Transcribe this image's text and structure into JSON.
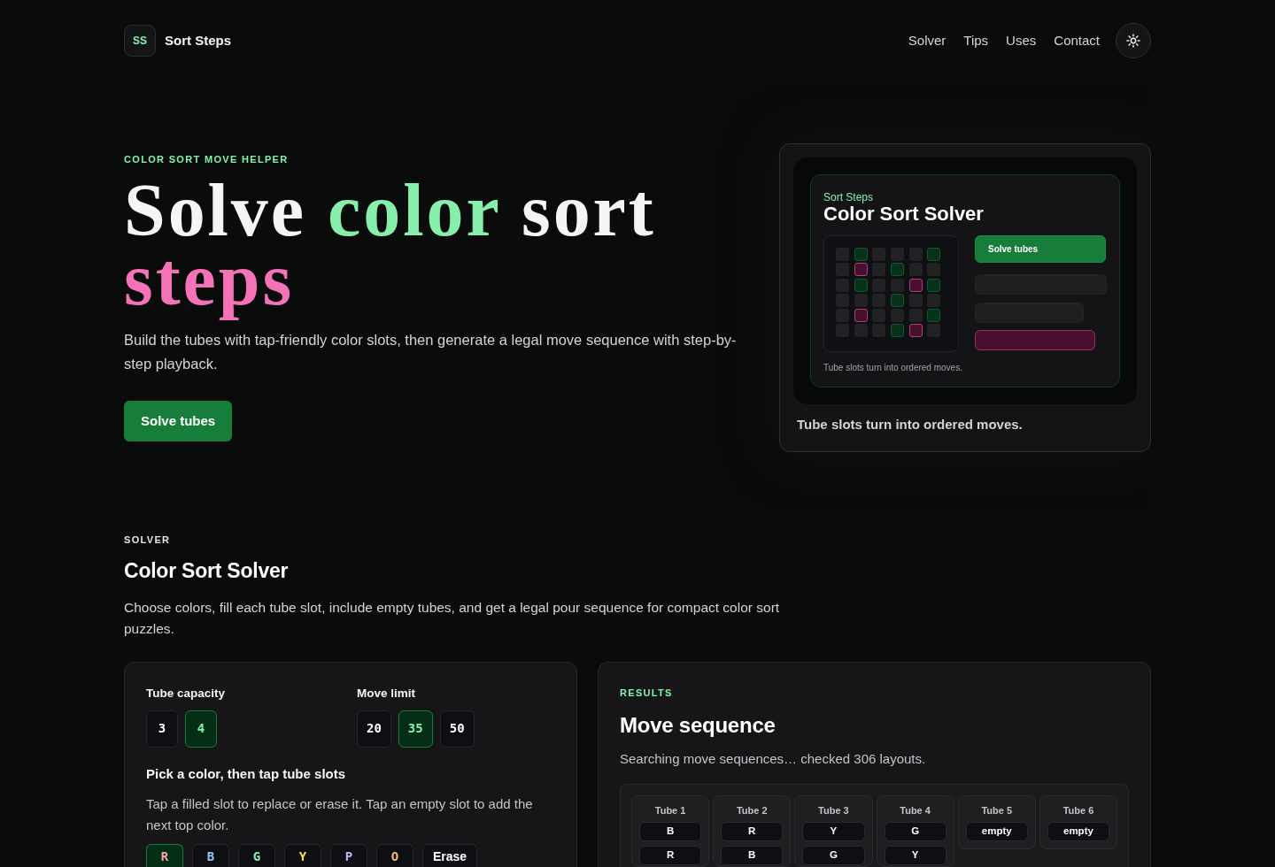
{
  "header": {
    "logo_mark": "SS",
    "brand": "Sort Steps",
    "nav": [
      {
        "label": "Solver"
      },
      {
        "label": "Tips"
      },
      {
        "label": "Uses"
      },
      {
        "label": "Contact"
      }
    ]
  },
  "hero": {
    "eyebrow": "COLOR SORT MOVE HELPER",
    "title_parts": [
      {
        "text": "Solve",
        "color": "#f5f5f5"
      },
      {
        "text": "color",
        "color": "#86efac"
      },
      {
        "text": "sort",
        "color": "#f5f5f5"
      },
      {
        "text": "steps",
        "color": "#f472b6"
      }
    ],
    "description": "Build the tubes with tap-friendly color slots, then generate a legal move sequence with step-by-step playback.",
    "cta": "Solve tubes"
  },
  "preview": {
    "brand": "Sort Steps",
    "title": "Color Sort Solver",
    "cells": [
      {
        "kind": "empty"
      },
      {
        "kind": "green"
      },
      {
        "kind": "empty"
      },
      {
        "kind": "empty"
      },
      {
        "kind": "empty"
      },
      {
        "kind": "green"
      },
      {
        "kind": "empty"
      },
      {
        "kind": "pink"
      },
      {
        "kind": "empty"
      },
      {
        "kind": "green"
      },
      {
        "kind": "empty"
      },
      {
        "kind": "empty"
      },
      {
        "kind": "empty"
      },
      {
        "kind": "green"
      },
      {
        "kind": "empty"
      },
      {
        "kind": "empty"
      },
      {
        "kind": "pink"
      },
      {
        "kind": "green"
      },
      {
        "kind": "empty"
      },
      {
        "kind": "empty"
      },
      {
        "kind": "empty"
      },
      {
        "kind": "green"
      },
      {
        "kind": "empty"
      },
      {
        "kind": "empty"
      },
      {
        "kind": "empty"
      },
      {
        "kind": "pink"
      },
      {
        "kind": "empty"
      },
      {
        "kind": "empty"
      },
      {
        "kind": "empty"
      },
      {
        "kind": "green"
      },
      {
        "kind": "empty"
      },
      {
        "kind": "empty"
      },
      {
        "kind": "empty"
      },
      {
        "kind": "green"
      },
      {
        "kind": "pink"
      },
      {
        "kind": "empty"
      }
    ],
    "button": "Solve tubes",
    "note": "Tube slots turn into ordered moves.",
    "caption": "Tube slots turn into ordered moves."
  },
  "solver": {
    "eyebrow": "SOLVER",
    "title": "Color Sort Solver",
    "description": "Choose colors, fill each tube slot, include empty tubes, and get a legal pour sequence for compact color sort puzzles.",
    "settings": [
      {
        "label": "Tube capacity",
        "options": [
          {
            "label": "3",
            "selected": false
          },
          {
            "label": "4",
            "selected": true
          }
        ]
      },
      {
        "label": "Move limit",
        "options": [
          {
            "label": "20",
            "selected": false
          },
          {
            "label": "35",
            "selected": true
          },
          {
            "label": "50",
            "selected": false
          }
        ]
      }
    ],
    "palette_title": "Pick a color, then tap tube slots",
    "palette_hint": "Tap a filled slot to replace or erase it. Tap an empty slot to add the next top color.",
    "palette": [
      {
        "kind": "color",
        "label": "R",
        "color": "#fca5a5",
        "selected": true
      },
      {
        "kind": "color",
        "label": "B",
        "color": "#93c5fd",
        "selected": false
      },
      {
        "kind": "color",
        "label": "G",
        "color": "#86efac",
        "selected": false
      },
      {
        "kind": "color",
        "label": "Y",
        "color": "#fde047",
        "selected": false
      },
      {
        "kind": "color",
        "label": "P",
        "color": "#c4b5fd",
        "selected": false
      },
      {
        "kind": "color",
        "label": "O",
        "color": "#fdba74",
        "selected": false
      },
      {
        "kind": "erase",
        "label": "Erase",
        "selected": false
      }
    ]
  },
  "results": {
    "eyebrow": "RESULTS",
    "title": "Move sequence",
    "status": "Searching move sequences… checked 306 layouts.",
    "tubes": [
      {
        "label": "Tube 1",
        "slots": [
          "B",
          "R"
        ]
      },
      {
        "label": "Tube 2",
        "slots": [
          "R",
          "B"
        ]
      },
      {
        "label": "Tube 3",
        "slots": [
          "Y",
          "G"
        ]
      },
      {
        "label": "Tube 4",
        "slots": [
          "G",
          "Y"
        ]
      },
      {
        "label": "Tube 5",
        "slots": [
          "empty"
        ]
      },
      {
        "label": "Tube 6",
        "slots": [
          "empty"
        ]
      }
    ]
  }
}
